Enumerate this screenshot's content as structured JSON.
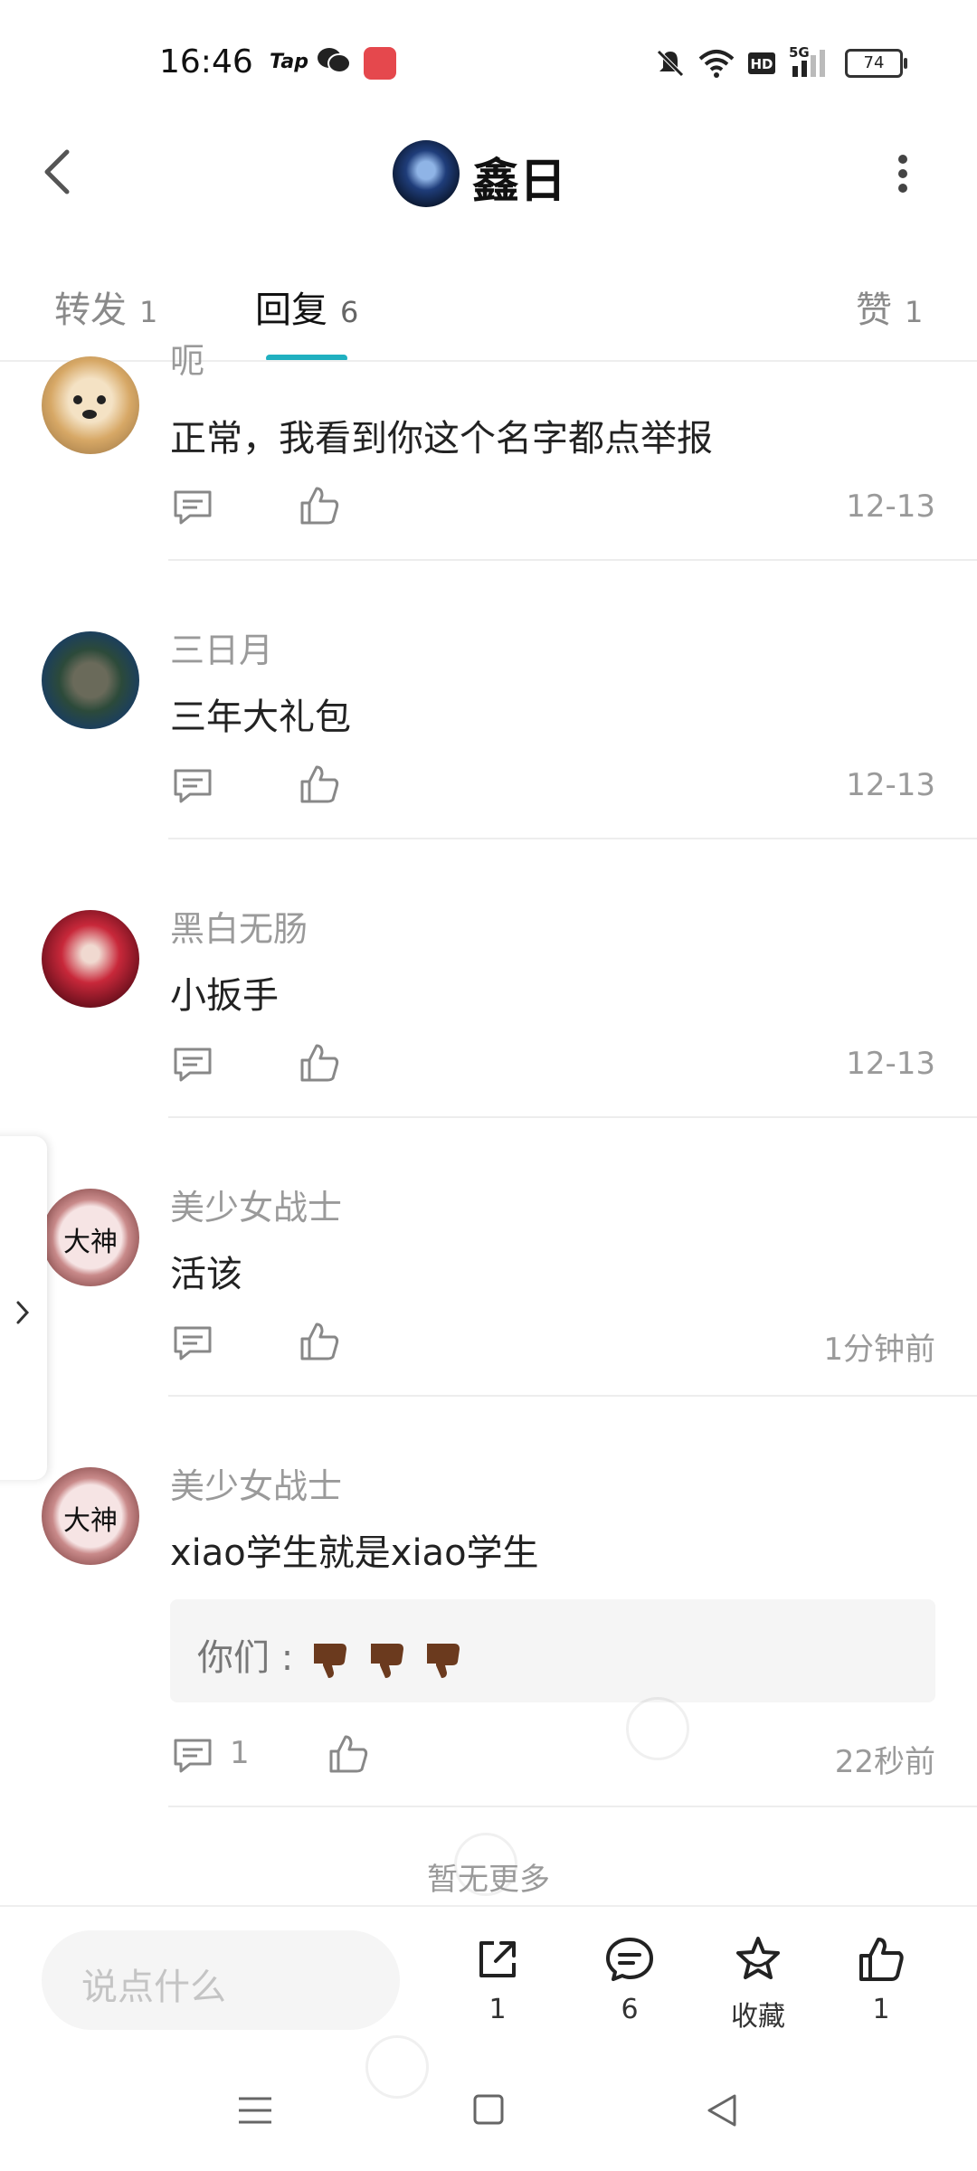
{
  "status_bar": {
    "time": "16:46",
    "app_icons": [
      "Tap",
      "wechat-icon",
      "app-icon"
    ],
    "battery": "74",
    "network": "5G"
  },
  "header": {
    "title": "鑫日"
  },
  "tabs": [
    {
      "label": "转发",
      "count": "1"
    },
    {
      "label": "回复",
      "count": "6",
      "active": true
    },
    {
      "label": "赞",
      "count": "1"
    }
  ],
  "comments": [
    {
      "name": "呃",
      "content": "正常，我看到你这个名字都点举报",
      "time": "12-13",
      "avatar": "dog-avatar"
    },
    {
      "name": "三日月",
      "content": "三年大礼包",
      "time": "12-13",
      "avatar": "planet-avatar"
    },
    {
      "name": "黑白无肠",
      "content": "小扳手",
      "time": "12-13",
      "avatar": "dragon-avatar"
    },
    {
      "name": "美少女战士",
      "content": "活该",
      "time": "1分钟前",
      "avatar": "dashen-avatar",
      "avatar_text": "大神"
    },
    {
      "name": "美少女战士",
      "content": "xiao学生就是xiao学生",
      "time": "22秒前",
      "avatar": "dashen-avatar",
      "avatar_text": "大神",
      "quote": {
        "prefix": "你们 :",
        "emoji": [
          "thumbs-down",
          "thumbs-down",
          "thumbs-down"
        ]
      },
      "reply_count": "1"
    }
  ],
  "footer_text": "暂无更多",
  "bottom_bar": {
    "input_placeholder": "说点什么",
    "actions": [
      {
        "icon": "share-icon",
        "label": "1"
      },
      {
        "icon": "comment-icon",
        "label": "6"
      },
      {
        "icon": "star-icon",
        "label": "收藏"
      },
      {
        "icon": "like-icon",
        "label": "1"
      }
    ]
  },
  "colors": {
    "accent": "#20b0c0",
    "text_primary": "#222222",
    "text_secondary": "#9a9a9a"
  }
}
